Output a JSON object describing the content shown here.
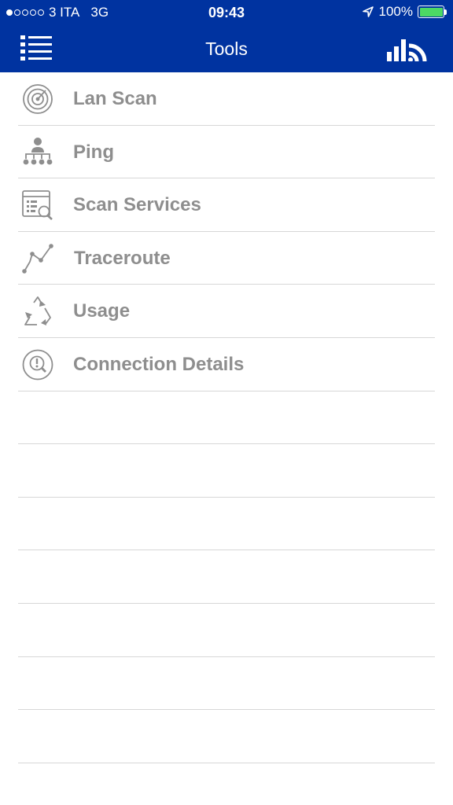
{
  "status_bar": {
    "carrier": "3 ITA",
    "network": "3G",
    "time": "09:43",
    "battery": "100%",
    "battery_level": 1.0,
    "signal_bars_filled": 1,
    "signal_bars_total": 5
  },
  "nav_bar": {
    "title": "Tools",
    "menu_icon": "list-icon",
    "right_icon": "signal-wifi-icon"
  },
  "colors": {
    "nav_background": "#0033a0",
    "label_text": "#8e8e8e",
    "separator": "#d7d7d7",
    "battery": "#4cd964"
  },
  "tools": {
    "items": [
      {
        "label": "Lan Scan",
        "icon": "radar-icon"
      },
      {
        "label": "Ping",
        "icon": "ping-network-icon"
      },
      {
        "label": "Scan Services",
        "icon": "scan-services-icon"
      },
      {
        "label": "Traceroute",
        "icon": "traceroute-icon"
      },
      {
        "label": "Usage",
        "icon": "recycle-icon"
      },
      {
        "label": "Connection Details",
        "icon": "connection-details-icon"
      }
    ]
  }
}
